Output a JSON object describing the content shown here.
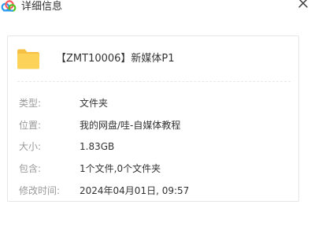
{
  "window": {
    "title": "详细信息",
    "app_icon": "cloud-icon",
    "close_icon": "close-icon",
    "accent_colors": [
      "#2b9cf2",
      "#ff5a5f",
      "#52c41a"
    ]
  },
  "file": {
    "icon": "folder-icon",
    "name": "【ZMT10006】新媒体P1"
  },
  "details": [
    {
      "label": "类型:",
      "value": "文件夹"
    },
    {
      "label": "位置:",
      "value": "我的网盘/哇-自媒体教程"
    },
    {
      "label": "大小:",
      "value": "1.83GB"
    },
    {
      "label": "包含:",
      "value": "1个文件,0个文件夹"
    },
    {
      "label": "修改时间:",
      "value": "2024年04月01日, 09:57"
    }
  ]
}
